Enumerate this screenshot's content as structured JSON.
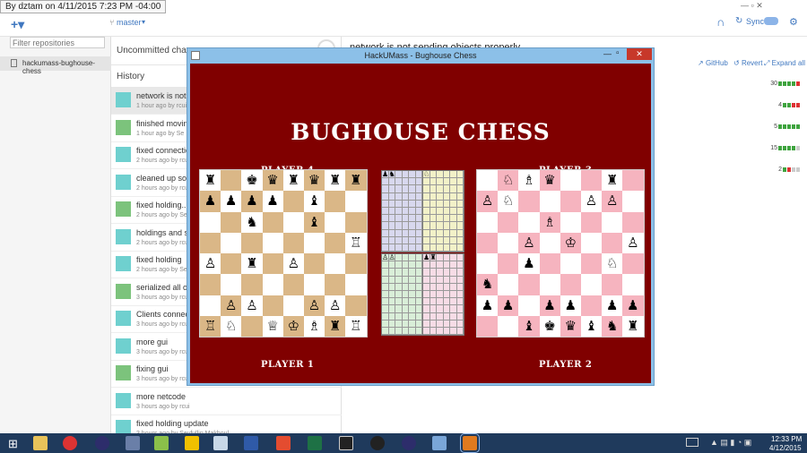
{
  "tooltip": "By dztam on 4/11/2015 7:23 PM -04:00",
  "github": {
    "branch": "master",
    "sync_label": "Sync",
    "filter_placeholder": "Filter repositories",
    "repo_name": "hackumass-bughouse-chess",
    "uncommitted": "Uncommitted chan",
    "history_label": "History",
    "selected_commit_title": "network is not sending objects properly",
    "actions": {
      "github": "GitHub",
      "revert": "Revert",
      "expand": "Expand all"
    },
    "commits": [
      {
        "title": "network is not s",
        "meta": "1 hour ago by rcui",
        "selected": true
      },
      {
        "title": "finished moving",
        "meta": "1 hour ago by Se",
        "selected": false
      },
      {
        "title": "fixed connectio",
        "meta": "2 hours ago by rcu",
        "selected": false
      },
      {
        "title": "cleaned up som",
        "meta": "2 hours ago by rcu",
        "selected": false
      },
      {
        "title": "fixed holding...a",
        "meta": "2 hours ago by Se",
        "selected": false
      },
      {
        "title": "holdings and st",
        "meta": "2 hours ago by rcu",
        "selected": false
      },
      {
        "title": "fixed holding",
        "meta": "2 hours ago by Se",
        "selected": false
      },
      {
        "title": "serialized all ob",
        "meta": "3 hours ago by rcu",
        "selected": false
      },
      {
        "title": "Clients connect",
        "meta": "3 hours ago by rcu",
        "selected": false
      },
      {
        "title": "more gui",
        "meta": "3 hours ago by rcu",
        "selected": false
      },
      {
        "title": "fixing gui",
        "meta": "3 hours ago by rcu",
        "selected": false
      },
      {
        "title": "more netcode",
        "meta": "3 hours ago by rcui",
        "selected": false
      },
      {
        "title": "fixed holding update",
        "meta": "3 hours ago by Seyfullin Makhoul",
        "selected": false
      }
    ],
    "file_changes": [
      {
        "count": "30",
        "bars": "ggggr"
      },
      {
        "count": "4",
        "bars": "ggrr"
      },
      {
        "count": "5",
        "bars": "ggggg"
      },
      {
        "count": "15",
        "bars": "gggge"
      },
      {
        "count": "2",
        "bars": "gree"
      }
    ]
  },
  "chess": {
    "window_title": "HackUMass - Bughouse Chess",
    "game_title": "BUGHOUSE CHESS",
    "players": {
      "p4": "PLAYER 4",
      "p3": "PLAYER 3",
      "p1": "PLAYER 1",
      "p2": "PLAYER 2"
    },
    "left_board": [
      "♜♖♚♛♜♛♜♜",
      "♟♟♟♟♟♝♟♟",
      "♜♖♞♝♛♝♜♜",
      "♜♖♞♝♛♝♙♖",
      "♙♝♜♝♙♛♜♜",
      "♜♖♞♝♛♝♜♜",
      "♜♙♙♝♛♙♙♖",
      "♖♘♞♕♔♗♜♖"
    ],
    "left_map": [
      "1.010100",
      "1111.0..",
      "..1..0..",
      ".......0",
      "0.1.0...",
      "........",
      ".00..00.",
      "00.00000"
    ],
    "right_board": [
      "♜♘♗♛♜♜♜♖",
      "♙♘♜♜♜♙♙♜",
      "♜♜♜♗♜♜♜♜",
      "♜♜♙♜♔♜♜♙",
      "♜♜♟♜♜♜♘♜",
      "♞♜♜♜♜♜♜♜",
      "♟♟♜♟♟♜♟♟",
      "♜♜♝♚♛♝♞♜"
    ],
    "right_map": [
      ".000..0.",
      "00...00.",
      "...0....",
      "..0.0..0",
      "..1...0.",
      "1.......",
      "11.11.11",
      "..111111"
    ],
    "pools": [
      {
        "pieces": "♟♞",
        "color": "#d8d8ee"
      },
      {
        "pieces": "♘",
        "color": "#f2f1c8"
      },
      {
        "pieces": "♙♙",
        "color": "#d9eed8"
      },
      {
        "pieces": "♟♜",
        "color": "#f6dce6"
      }
    ],
    "colors": {
      "bg": "#800000",
      "left_dark": "#dab787",
      "right_dark": "#f6b4bf",
      "light": "#ffffff"
    }
  },
  "taskbar": {
    "time": "12:33 PM",
    "date": "4/12/2015"
  }
}
